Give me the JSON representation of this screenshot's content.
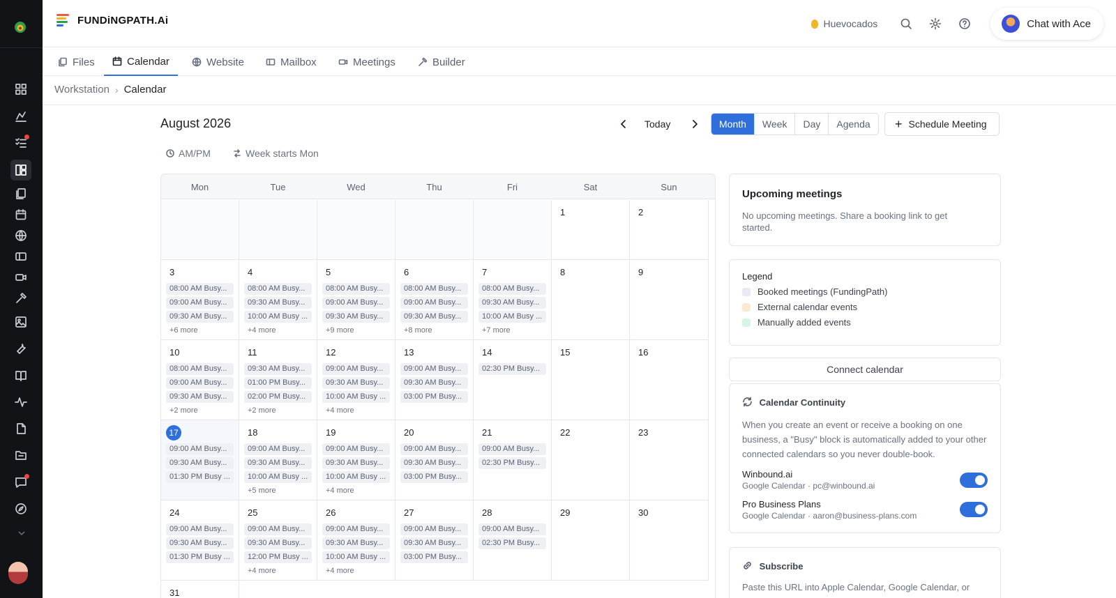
{
  "app": {
    "brand": "FUNDiNGPATH.Ai",
    "workspace": "Huevocados",
    "chat_label": "Chat with Ace"
  },
  "colors": {
    "accent": "#2f6fdb",
    "notification": "#ef4444",
    "booked": "#e8eaf6",
    "external": "#fde9cf",
    "manual": "#d7f5e3"
  },
  "rail_icons": [
    "dashboard-icon",
    "analytics-icon",
    "tasks-icon",
    "workstation-icon",
    "files-icon",
    "calendar-icon",
    "website-icon",
    "mailbox-icon",
    "meetings-icon",
    "builder-icon",
    "image-icon",
    "tools-icon",
    "book-icon",
    "activity-icon",
    "notes-icon",
    "folder-icon",
    "chat-icon",
    "compass-icon"
  ],
  "tabs": [
    {
      "label": "Files",
      "icon": "files-icon"
    },
    {
      "label": "Calendar",
      "icon": "calendar-icon",
      "active": true
    },
    {
      "label": "Website",
      "icon": "globe-icon"
    },
    {
      "label": "Mailbox",
      "icon": "mailbox-icon"
    },
    {
      "label": "Meetings",
      "icon": "video-icon"
    },
    {
      "label": "Builder",
      "icon": "hammer-icon"
    }
  ],
  "breadcrumb": {
    "parent": "Workstation",
    "current": "Calendar"
  },
  "calendar": {
    "title": "August 2026",
    "today_label": "Today",
    "views": [
      "Month",
      "Week",
      "Day",
      "Agenda"
    ],
    "active_view": "Month",
    "schedule_label": "Schedule Meeting",
    "option_ampm": "AM/PM",
    "option_week": "Week starts Mon",
    "weekdays": [
      "Mon",
      "Tue",
      "Wed",
      "Thu",
      "Fri",
      "Sat",
      "Sun"
    ],
    "weeks": [
      [
        {
          "day": ""
        },
        {
          "day": ""
        },
        {
          "day": ""
        },
        {
          "day": ""
        },
        {
          "day": ""
        },
        {
          "day": "1",
          "events": []
        },
        {
          "day": "2",
          "events": []
        }
      ],
      [
        {
          "day": "3",
          "events": [
            "08:00 AM Busy...",
            "09:00 AM Busy...",
            "09:30 AM Busy..."
          ],
          "more": "+6 more"
        },
        {
          "day": "4",
          "events": [
            "08:00 AM Busy...",
            "09:30 AM Busy...",
            "10:00 AM Busy ..."
          ],
          "more": "+4 more"
        },
        {
          "day": "5",
          "events": [
            "08:00 AM Busy...",
            "09:00 AM Busy...",
            "09:30 AM Busy..."
          ],
          "more": "+9 more"
        },
        {
          "day": "6",
          "events": [
            "08:00 AM Busy...",
            "09:00 AM Busy...",
            "09:30 AM Busy..."
          ],
          "more": "+8 more"
        },
        {
          "day": "7",
          "events": [
            "08:00 AM Busy...",
            "09:30 AM Busy...",
            "10:00 AM Busy ..."
          ],
          "more": "+7 more"
        },
        {
          "day": "8",
          "events": []
        },
        {
          "day": "9",
          "events": []
        }
      ],
      [
        {
          "day": "10",
          "events": [
            "08:00 AM Busy...",
            "09:00 AM Busy...",
            "09:30 AM Busy..."
          ],
          "more": "+2 more"
        },
        {
          "day": "11",
          "events": [
            "09:30 AM Busy...",
            "01:00 PM Busy...",
            "02:00 PM Busy..."
          ],
          "more": "+2 more"
        },
        {
          "day": "12",
          "events": [
            "09:00 AM Busy...",
            "09:30 AM Busy...",
            "10:00 AM Busy ..."
          ],
          "more": "+4 more"
        },
        {
          "day": "13",
          "events": [
            "09:00 AM Busy...",
            "09:30 AM Busy...",
            "03:00 PM Busy..."
          ]
        },
        {
          "day": "14",
          "events": [
            "02:30 PM Busy..."
          ]
        },
        {
          "day": "15",
          "events": []
        },
        {
          "day": "16",
          "events": []
        }
      ],
      [
        {
          "day": "17",
          "today": true,
          "events": [
            "09:00 AM Busy...",
            "09:30 AM Busy...",
            "01:30 PM Busy ..."
          ]
        },
        {
          "day": "18",
          "events": [
            "09:00 AM Busy...",
            "09:30 AM Busy...",
            "10:00 AM Busy ..."
          ],
          "more": "+5 more"
        },
        {
          "day": "19",
          "events": [
            "09:00 AM Busy...",
            "09:30 AM Busy...",
            "10:00 AM Busy ..."
          ],
          "more": "+4 more"
        },
        {
          "day": "20",
          "events": [
            "09:00 AM Busy...",
            "09:30 AM Busy...",
            "03:00 PM Busy..."
          ]
        },
        {
          "day": "21",
          "events": [
            "09:00 AM Busy...",
            "02:30 PM Busy..."
          ]
        },
        {
          "day": "22",
          "events": []
        },
        {
          "day": "23",
          "events": []
        }
      ],
      [
        {
          "day": "24",
          "events": [
            "09:00 AM Busy...",
            "09:30 AM Busy...",
            "01:30 PM Busy ..."
          ]
        },
        {
          "day": "25",
          "events": [
            "09:00 AM Busy...",
            "09:30 AM Busy...",
            "12:00 PM Busy ..."
          ],
          "more": "+4 more"
        },
        {
          "day": "26",
          "events": [
            "09:00 AM Busy...",
            "09:30 AM Busy...",
            "10:00 AM Busy ..."
          ],
          "more": "+4 more"
        },
        {
          "day": "27",
          "events": [
            "09:00 AM Busy...",
            "09:30 AM Busy...",
            "03:00 PM Busy..."
          ]
        },
        {
          "day": "28",
          "events": [
            "09:00 AM Busy...",
            "02:30 PM Busy..."
          ]
        },
        {
          "day": "29",
          "events": []
        },
        {
          "day": "30",
          "events": []
        }
      ],
      [
        {
          "day": "31",
          "events": []
        }
      ]
    ]
  },
  "upcoming": {
    "title": "Upcoming meetings",
    "text": "No upcoming meetings. Share a booking link to get started."
  },
  "legend": {
    "title": "Legend",
    "items": [
      {
        "label": "Booked meetings (FundingPath)",
        "color": "#e8eaf6"
      },
      {
        "label": "External calendar events",
        "color": "#fde9cf"
      },
      {
        "label": "Manually added events",
        "color": "#d7f5e3"
      }
    ]
  },
  "connect_label": "Connect calendar",
  "continuity": {
    "title": "Calendar Continuity",
    "text": "When you create an event or receive a booking on one business, a \"Busy\" block is automatically added to your other connected calendars so you never double-book.",
    "accounts": [
      {
        "name": "Winbound.ai",
        "sub": "Google Calendar · pc@winbound.ai",
        "enabled": true
      },
      {
        "name": "Pro Business Plans",
        "sub": "Google Calendar · aaron@business-plans.com",
        "enabled": true
      }
    ]
  },
  "subscribe": {
    "title": "Subscribe",
    "text": "Paste this URL into Apple Calendar, Google Calendar, or"
  }
}
